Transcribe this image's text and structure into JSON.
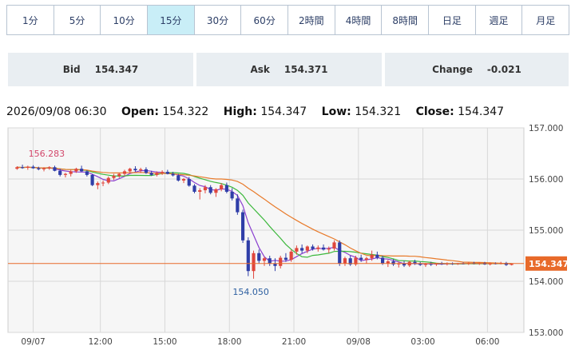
{
  "tabs": [
    {
      "label": "1分",
      "active": false
    },
    {
      "label": "5分",
      "active": false
    },
    {
      "label": "10分",
      "active": false
    },
    {
      "label": "15分",
      "active": true
    },
    {
      "label": "30分",
      "active": false
    },
    {
      "label": "60分",
      "active": false
    },
    {
      "label": "2時間",
      "active": false
    },
    {
      "label": "4時間",
      "active": false
    },
    {
      "label": "8時間",
      "active": false
    },
    {
      "label": "日足",
      "active": false
    },
    {
      "label": "週足",
      "active": false
    },
    {
      "label": "月足",
      "active": false
    }
  ],
  "quote": {
    "bid_label": "Bid",
    "bid_value": "154.347",
    "ask_label": "Ask",
    "ask_value": "154.371",
    "change_label": "Change",
    "change_value": "-0.021"
  },
  "ohlc": {
    "datetime": "2026/09/08 06:30",
    "open_label": "Open:",
    "open_value": "154.322",
    "high_label": "High:",
    "high_value": "154.347",
    "low_label": "Low:",
    "low_value": "154.321",
    "close_label": "Close:",
    "close_value": "154.347"
  },
  "colors": {
    "up": "#e0463c",
    "down": "#2f3ea8",
    "ma_short": "#8a3fd0",
    "ma_mid": "#3cb83c",
    "ma_long": "#e87a2a",
    "current": "#e86a2a",
    "peak": "#d2476b",
    "trough": "#2d5fa0"
  },
  "chart_data": {
    "type": "candlestick",
    "ylim": [
      153.0,
      157.0
    ],
    "y_ticks": [
      "157.000",
      "156.000",
      "155.000",
      "154.000",
      "153.000"
    ],
    "x_ticks": [
      "09/07",
      "12:00",
      "15:00",
      "18:00",
      "21:00",
      "09/08",
      "03:00",
      "06:00"
    ],
    "current_price": "154.347",
    "peak_label": "156.283",
    "trough_label": "154.050",
    "peak_value": 156.283,
    "trough_value": 154.05,
    "candles": [
      [
        156.2,
        156.25,
        156.18,
        156.23
      ],
      [
        156.23,
        156.28,
        156.2,
        156.22
      ],
      [
        156.22,
        156.26,
        156.18,
        156.24
      ],
      [
        156.24,
        156.27,
        156.2,
        156.21
      ],
      [
        156.21,
        156.24,
        156.17,
        156.19
      ],
      [
        156.19,
        156.23,
        156.15,
        156.21
      ],
      [
        156.21,
        156.25,
        156.18,
        156.23
      ],
      [
        156.23,
        156.26,
        156.15,
        156.16
      ],
      [
        156.16,
        156.2,
        156.05,
        156.08
      ],
      [
        156.08,
        156.12,
        156.03,
        156.1
      ],
      [
        156.1,
        156.18,
        156.05,
        156.15
      ],
      [
        156.15,
        156.22,
        156.12,
        156.2
      ],
      [
        156.2,
        156.26,
        156.14,
        156.15
      ],
      [
        156.15,
        156.17,
        156.05,
        156.08
      ],
      [
        156.08,
        156.1,
        155.86,
        155.88
      ],
      [
        155.88,
        155.95,
        155.8,
        155.92
      ],
      [
        155.92,
        155.97,
        155.86,
        155.93
      ],
      [
        155.93,
        156.05,
        155.9,
        156.02
      ],
      [
        156.02,
        156.1,
        155.98,
        156.06
      ],
      [
        156.06,
        156.12,
        156.02,
        156.1
      ],
      [
        156.1,
        156.18,
        156.06,
        156.15
      ],
      [
        156.15,
        156.22,
        156.12,
        156.2
      ],
      [
        156.2,
        156.25,
        156.14,
        156.17
      ],
      [
        156.17,
        156.22,
        156.12,
        156.19
      ],
      [
        156.19,
        156.23,
        156.1,
        156.12
      ],
      [
        156.12,
        156.16,
        156.06,
        156.08
      ],
      [
        156.08,
        156.15,
        156.05,
        156.12
      ],
      [
        156.12,
        156.17,
        156.08,
        156.14
      ],
      [
        156.14,
        156.18,
        156.09,
        156.1
      ],
      [
        156.1,
        156.14,
        156.05,
        156.07
      ],
      [
        156.07,
        156.1,
        155.95,
        155.97
      ],
      [
        155.97,
        156.02,
        155.92,
        156.0
      ],
      [
        156.0,
        156.04,
        155.85,
        155.87
      ],
      [
        155.87,
        155.9,
        155.72,
        155.75
      ],
      [
        155.75,
        155.82,
        155.6,
        155.78
      ],
      [
        155.78,
        155.88,
        155.72,
        155.84
      ],
      [
        155.84,
        155.88,
        155.7,
        155.73
      ],
      [
        155.73,
        155.82,
        155.65,
        155.8
      ],
      [
        155.8,
        155.92,
        155.76,
        155.88
      ],
      [
        155.88,
        155.93,
        155.72,
        155.75
      ],
      [
        155.75,
        155.82,
        155.58,
        155.62
      ],
      [
        155.62,
        155.7,
        155.3,
        155.35
      ],
      [
        155.35,
        155.4,
        154.75,
        154.8
      ],
      [
        154.8,
        154.86,
        154.1,
        154.2
      ],
      [
        154.2,
        154.6,
        154.05,
        154.55
      ],
      [
        154.55,
        154.62,
        154.35,
        154.4
      ],
      [
        154.4,
        154.48,
        154.3,
        154.45
      ],
      [
        154.45,
        154.5,
        154.3,
        154.35
      ],
      [
        154.35,
        154.45,
        154.2,
        154.3
      ],
      [
        154.3,
        154.5,
        154.25,
        154.46
      ],
      [
        154.46,
        154.55,
        154.38,
        154.42
      ],
      [
        154.42,
        154.62,
        154.38,
        154.58
      ],
      [
        154.58,
        154.7,
        154.52,
        154.65
      ],
      [
        154.65,
        154.72,
        154.55,
        154.6
      ],
      [
        154.6,
        154.7,
        154.55,
        154.68
      ],
      [
        154.68,
        154.72,
        154.6,
        154.63
      ],
      [
        154.63,
        154.7,
        154.58,
        154.66
      ],
      [
        154.66,
        154.72,
        154.6,
        154.62
      ],
      [
        154.62,
        154.68,
        154.55,
        154.64
      ],
      [
        154.64,
        154.8,
        154.6,
        154.76
      ],
      [
        154.76,
        154.8,
        154.3,
        154.35
      ],
      [
        154.35,
        154.48,
        154.3,
        154.45
      ],
      [
        154.45,
        154.5,
        154.3,
        154.33
      ],
      [
        154.33,
        154.5,
        154.3,
        154.46
      ],
      [
        154.46,
        154.52,
        154.38,
        154.42
      ],
      [
        154.42,
        154.48,
        154.35,
        154.45
      ],
      [
        154.45,
        154.6,
        154.4,
        154.52
      ],
      [
        154.52,
        154.58,
        154.43,
        154.46
      ],
      [
        154.46,
        154.5,
        154.32,
        154.35
      ],
      [
        154.35,
        154.42,
        154.28,
        154.39
      ],
      [
        154.39,
        154.43,
        154.3,
        154.33
      ],
      [
        154.33,
        154.38,
        154.27,
        154.35
      ],
      [
        154.35,
        154.4,
        154.28,
        154.31
      ],
      [
        154.31,
        154.4,
        154.28,
        154.38
      ],
      [
        154.38,
        154.42,
        154.32,
        154.35
      ],
      [
        154.35,
        154.38,
        154.3,
        154.32
      ],
      [
        154.32,
        154.36,
        154.28,
        154.34
      ],
      [
        154.34,
        154.38,
        154.3,
        154.33
      ],
      [
        154.33,
        154.36,
        154.3,
        154.35
      ],
      [
        154.35,
        154.38,
        154.32,
        154.34
      ],
      [
        154.34,
        154.37,
        154.31,
        154.35
      ],
      [
        154.35,
        154.37,
        154.32,
        154.34
      ],
      [
        154.34,
        154.36,
        154.32,
        154.35
      ],
      [
        154.35,
        154.37,
        154.33,
        154.34
      ],
      [
        154.34,
        154.37,
        154.32,
        154.36
      ],
      [
        154.36,
        154.38,
        154.33,
        154.34
      ],
      [
        154.34,
        154.37,
        154.32,
        154.36
      ],
      [
        154.36,
        154.38,
        154.32,
        154.33
      ],
      [
        154.33,
        154.37,
        154.31,
        154.35
      ],
      [
        154.35,
        154.37,
        154.33,
        154.34
      ],
      [
        154.34,
        154.38,
        154.33,
        154.36
      ],
      [
        154.36,
        154.38,
        154.3,
        154.32
      ],
      [
        154.32,
        154.35,
        154.31,
        154.347
      ]
    ]
  }
}
